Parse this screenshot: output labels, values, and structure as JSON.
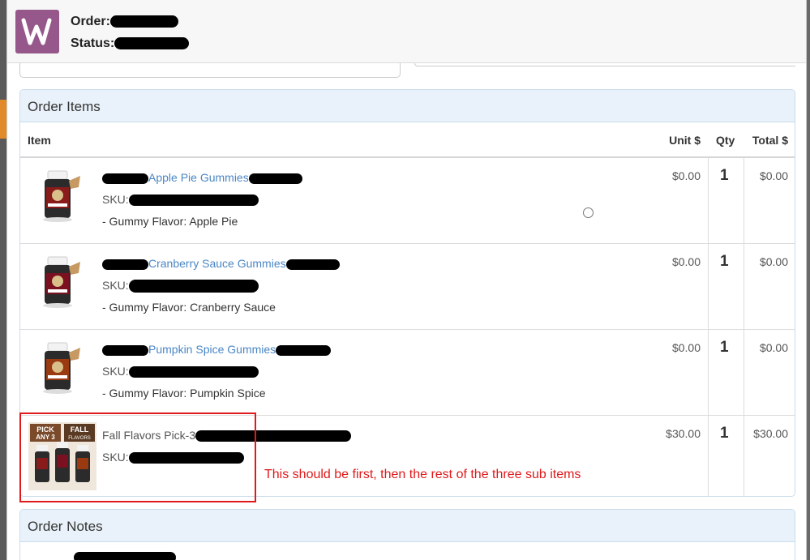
{
  "header": {
    "order_label": "Order:",
    "status_label": "Status:"
  },
  "order_items": {
    "title": "Order Items",
    "columns": {
      "item": "Item",
      "unit": "Unit $",
      "qty": "Qty",
      "total": "Total $"
    },
    "rows": [
      {
        "name": "Apple Pie Gummies",
        "sku_label": "SKU:",
        "meta": "- Gummy Flavor: Apple Pie",
        "unit": "$0.00",
        "qty": "1",
        "total": "$0.00"
      },
      {
        "name": "Cranberry Sauce Gummies",
        "sku_label": "SKU:",
        "meta": "- Gummy Flavor: Cranberry Sauce",
        "unit": "$0.00",
        "qty": "1",
        "total": "$0.00"
      },
      {
        "name": "Pumpkin Spice Gummies",
        "sku_label": "SKU:",
        "meta": "- Gummy Flavor: Pumpkin Spice",
        "unit": "$0.00",
        "qty": "1",
        "total": "$0.00"
      },
      {
        "name": "Fall Flavors Pick-3",
        "sku_label": "SKU:",
        "meta": "",
        "unit": "$30.00",
        "qty": "1",
        "total": "$30.00",
        "thumb_text": {
          "left_top": "PICK",
          "left_bottom": "ANY 3",
          "right_top": "FALL",
          "right_bottom": "FLAVORS"
        }
      }
    ]
  },
  "annotation": "This should be first, then the rest of the three sub items",
  "order_notes": {
    "title": "Order Notes"
  },
  "colors": {
    "brand": "#96588a",
    "link": "#4a86c5",
    "annotation": "#e0191a",
    "panel_header": "#e9f2fa"
  }
}
